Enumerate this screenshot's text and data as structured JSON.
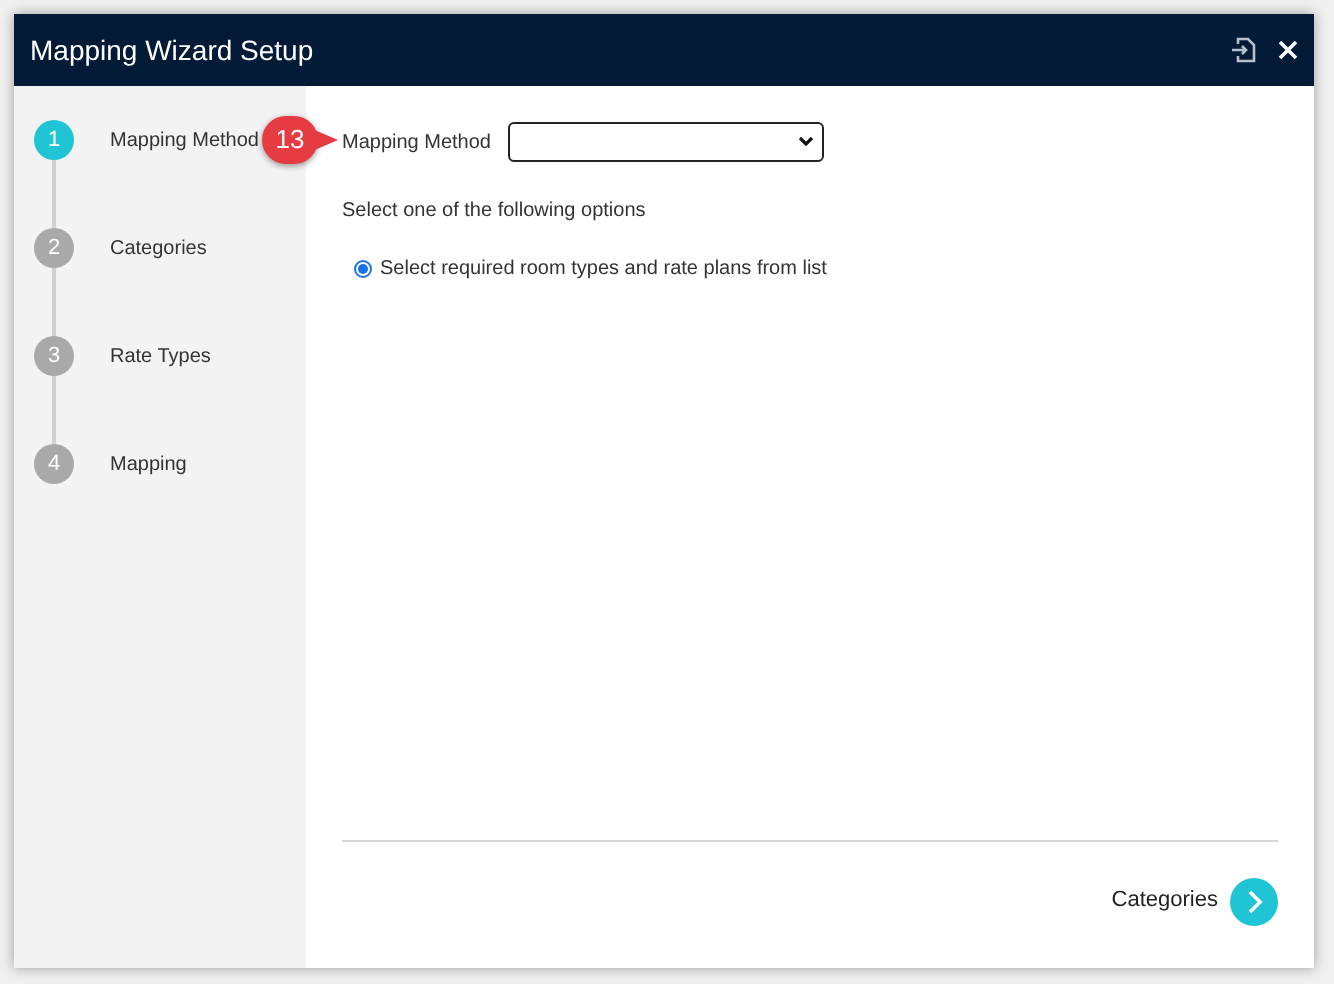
{
  "window": {
    "title": "Mapping Wizard Setup"
  },
  "steps": [
    {
      "number": "1",
      "label": "Mapping Method",
      "selected": true
    },
    {
      "number": "2",
      "label": "Categories",
      "selected": false
    },
    {
      "number": "3",
      "label": "Rate Types",
      "selected": false
    },
    {
      "number": "4",
      "label": "Mapping",
      "selected": false
    }
  ],
  "callout": {
    "text": "13"
  },
  "form": {
    "label": "Mapping Method",
    "instruction": "Select one of the following options",
    "options": [
      {
        "label": "Select required room types and rate plans from list",
        "selected": true
      }
    ]
  },
  "footer": {
    "next_label": "Categories"
  }
}
